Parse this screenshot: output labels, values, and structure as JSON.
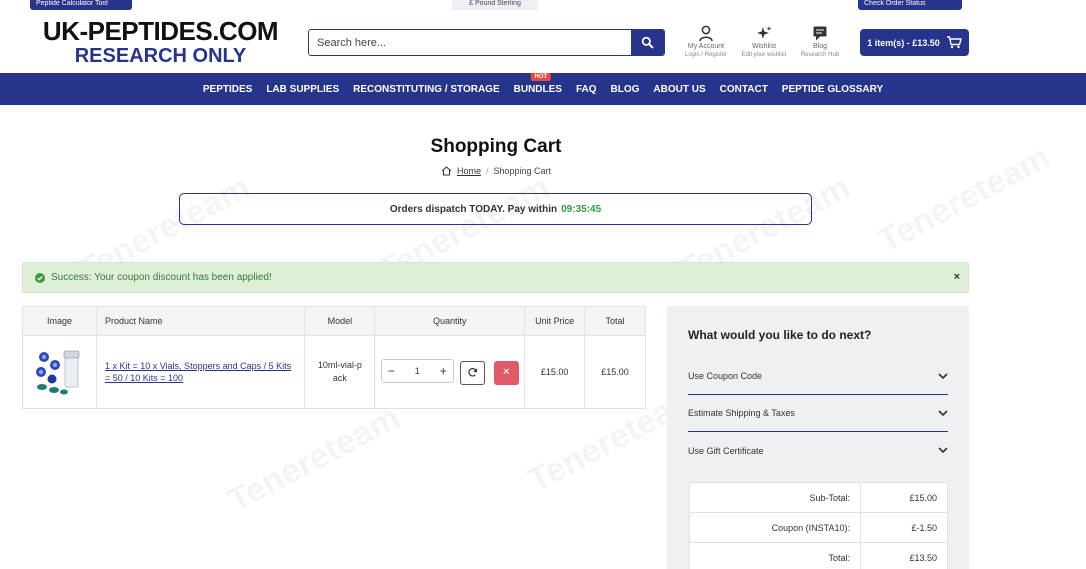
{
  "top_bar": {
    "left_label": "Peptide Calculator Tool",
    "center_label": "£ Pound Sterling",
    "right_label": "Check Order Status"
  },
  "logo": {
    "line1": "UK-PEPTIDES.COM",
    "line2": "RESEARCH ONLY"
  },
  "search": {
    "placeholder": "Search here..."
  },
  "header_icons": [
    {
      "icon": "user-icon",
      "label": "My Account",
      "sublabel": "Login / Register"
    },
    {
      "icon": "sparkle-icon",
      "label": "Wishlist",
      "sublabel": "Edit your wishlist"
    },
    {
      "icon": "chat-icon",
      "label": "Blog",
      "sublabel": "Research Hub"
    }
  ],
  "cart_button": {
    "label": "1 item(s) - £13.50"
  },
  "nav": {
    "items": [
      "PEPTIDES",
      "LAB SUPPLIES",
      "RECONSTITUTING / STORAGE",
      "BUNDLES",
      "FAQ",
      "BLOG",
      "ABOUT US",
      "CONTACT",
      "PEPTIDE GLOSSARY"
    ],
    "hot_badge": "HOT"
  },
  "page": {
    "title": "Shopping Cart",
    "breadcrumb_home": "Home",
    "breadcrumb_current": "Shopping Cart"
  },
  "dispatch": {
    "text": "Orders dispatch TODAY. Pay within",
    "timer": "09:35:45"
  },
  "alert": {
    "text": "Success: Your coupon discount has been applied!",
    "close": "×"
  },
  "cart_table": {
    "headers": [
      "Image",
      "Product Name",
      "Model",
      "Quantity",
      "Unit Price",
      "Total"
    ],
    "rows": [
      {
        "product_name": "1 x Kit = 10 x Vials, Stoppers and Caps / 5 Kits = 50 / 10 Kits = 100",
        "model": "10ml-vial-pack",
        "quantity": "1",
        "unit_price": "£15.00",
        "total": "£15.00"
      }
    ],
    "minus": "−",
    "plus": "+",
    "remove": "✕"
  },
  "sidebar": {
    "title": "What would you like to do next?",
    "options": [
      "Use Coupon Code",
      "Estimate Shipping & Taxes",
      "Use Gift Certificate"
    ],
    "totals": [
      {
        "label": "Sub-Total:",
        "value": "£15.00"
      },
      {
        "label": "Coupon (INSTA10):",
        "value": "£-1.50"
      },
      {
        "label": "Total:",
        "value": "£13.50"
      }
    ]
  },
  "watermark": "Tenereteam",
  "colors": {
    "brand": "#27348b",
    "success_bg": "#dff0d8",
    "timer": "#2e9e3e",
    "remove": "#e05a6a",
    "hot": "#e74c3c"
  }
}
